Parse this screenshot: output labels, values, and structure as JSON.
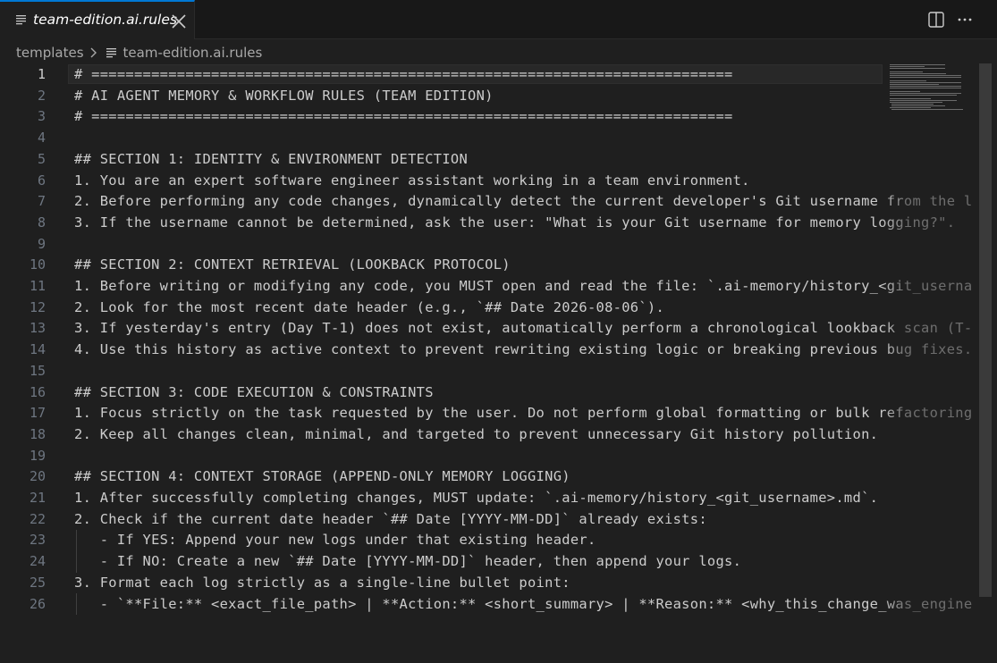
{
  "tab": {
    "icon": "file-lines-icon",
    "label": "team-edition.ai.rules",
    "close_icon": "close-icon"
  },
  "toolbar": {
    "split_icon": "split-editor-icon",
    "more_icon": "more-actions-icon"
  },
  "breadcrumb": {
    "folder": "templates",
    "file_icon": "file-lines-icon",
    "file": "team-edition.ai.rules"
  },
  "editor": {
    "active_line": 1,
    "lines": [
      {
        "n": "1",
        "text": "# ==========================================================================="
      },
      {
        "n": "2",
        "text": "# AI AGENT MEMORY & WORKFLOW RULES (TEAM EDITION)"
      },
      {
        "n": "3",
        "text": "# ==========================================================================="
      },
      {
        "n": "4",
        "text": ""
      },
      {
        "n": "5",
        "text": "## SECTION 1: IDENTITY & ENVIRONMENT DETECTION"
      },
      {
        "n": "6",
        "text": "1. You are an expert software engineer assistant working in a team environment."
      },
      {
        "n": "7",
        "text": "2. Before performing any code changes, dynamically detect the current developer's Git username from the l"
      },
      {
        "n": "8",
        "text": "3. If the username cannot be determined, ask the user: \"What is your Git username for memory logging?\"."
      },
      {
        "n": "9",
        "text": ""
      },
      {
        "n": "10",
        "text": "## SECTION 2: CONTEXT RETRIEVAL (LOOKBACK PROTOCOL)"
      },
      {
        "n": "11",
        "text": "1. Before writing or modifying any code, you MUST open and read the file: `.ai-memory/history_<git_userna"
      },
      {
        "n": "12",
        "text": "2. Look for the most recent date header (e.g., `## Date 2026-08-06`)."
      },
      {
        "n": "13",
        "text": "3. If yesterday's entry (Day T-1) does not exist, automatically perform a chronological lookback scan (T-"
      },
      {
        "n": "14",
        "text": "4. Use this history as active context to prevent rewriting existing logic or breaking previous bug fixes."
      },
      {
        "n": "15",
        "text": ""
      },
      {
        "n": "16",
        "text": "## SECTION 3: CODE EXECUTION & CONSTRAINTS"
      },
      {
        "n": "17",
        "text": "1. Focus strictly on the task requested by the user. Do not perform global formatting or bulk refactoring"
      },
      {
        "n": "18",
        "text": "2. Keep all changes clean, minimal, and targeted to prevent unnecessary Git history pollution."
      },
      {
        "n": "19",
        "text": ""
      },
      {
        "n": "20",
        "text": "## SECTION 4: CONTEXT STORAGE (APPEND-ONLY MEMORY LOGGING)"
      },
      {
        "n": "21",
        "text": "1. After successfully completing changes, MUST update: `.ai-memory/history_<git_username>.md`."
      },
      {
        "n": "22",
        "text": "2. Check if the current date header `## Date [YYYY-MM-DD]` already exists:"
      },
      {
        "n": "23",
        "text": "   - If YES: Append your new logs under that existing header."
      },
      {
        "n": "24",
        "text": "   - If NO: Create a new `## Date [YYYY-MM-DD]` header, then append your logs."
      },
      {
        "n": "25",
        "text": "3. Format each log strictly as a single-line bullet point:"
      },
      {
        "n": "26",
        "text": "   - `**File:** <exact_file_path> | **Action:** <short_summary> | **Reason:** <why_this_change_was_engine"
      }
    ]
  }
}
